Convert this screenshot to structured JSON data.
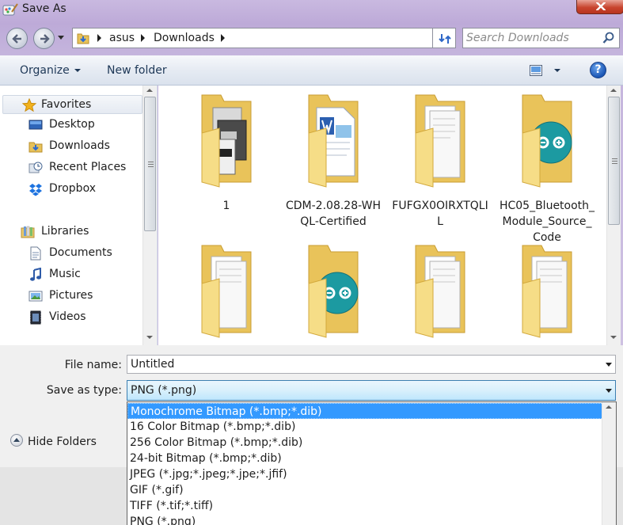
{
  "window": {
    "title": "Save As"
  },
  "address": {
    "crumbs": [
      "asus",
      "Downloads"
    ]
  },
  "search": {
    "placeholder": "Search Downloads"
  },
  "toolbar": {
    "organize_label": "Organize",
    "new_folder_label": "New folder",
    "help_label": "?"
  },
  "nav": {
    "favorites_label": "Favorites",
    "favorites": [
      {
        "label": "Desktop"
      },
      {
        "label": "Downloads"
      },
      {
        "label": "Recent Places"
      },
      {
        "label": "Dropbox"
      }
    ],
    "libraries_label": "Libraries",
    "libraries": [
      {
        "label": "Documents"
      },
      {
        "label": "Music"
      },
      {
        "label": "Pictures"
      },
      {
        "label": "Videos"
      }
    ]
  },
  "files": {
    "items": [
      {
        "label": "1"
      },
      {
        "label": "CDM-2.08.28-WHQL-Certified"
      },
      {
        "label": "FUFGX0OIRXTQLIL"
      },
      {
        "label": "HC05_Bluetooth_Module_Source_Code"
      },
      {
        "label": ""
      },
      {
        "label": ""
      },
      {
        "label": ""
      },
      {
        "label": ""
      }
    ]
  },
  "form": {
    "file_name_label": "File name:",
    "file_name_value": "Untitled",
    "save_type_label": "Save as type:",
    "save_type_value": "PNG (*.png)",
    "hide_folders_label": "Hide Folders"
  },
  "type_options": [
    "Monochrome Bitmap (*.bmp;*.dib)",
    "16 Color Bitmap (*.bmp;*.dib)",
    "256 Color Bitmap (*.bmp;*.dib)",
    "24-bit Bitmap (*.bmp;*.dib)",
    "JPEG (*.jpg;*.jpeg;*.jpe;*.jfif)",
    "GIF (*.gif)",
    "TIFF (*.tif;*.tiff)",
    "PNG (*.png)"
  ],
  "colors": {
    "selection": "#3399ff",
    "folder": "#f3d77c",
    "arduino": "#1c9aa1"
  }
}
